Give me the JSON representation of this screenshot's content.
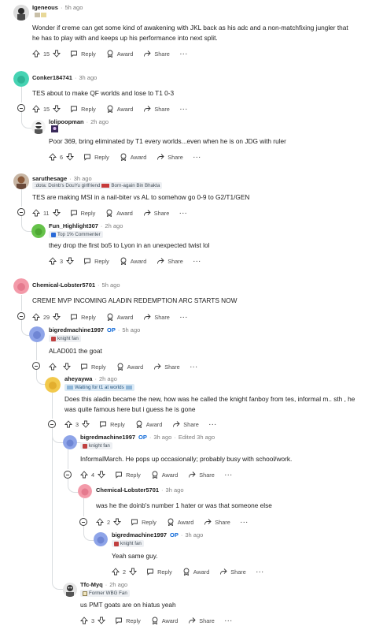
{
  "labels": {
    "reply": "Reply",
    "award": "Award",
    "share": "Share",
    "more": "···",
    "sep": "·"
  },
  "colors": {
    "op": "#0a66d8",
    "thread_line": "#dadde0",
    "text": "#1c1c1c"
  },
  "comments": {
    "c1": {
      "user": "Igeneous",
      "time": "5h ago",
      "flair_icons": [
        "emoji-badge-icon"
      ],
      "lines": [
        "Wonder if creme can get some kind of awakening with JKL back as his adc and a non-matchfixing jungler that",
        "he has to play with and keeps up his performance into next split."
      ],
      "votes": "15"
    },
    "c2": {
      "user": "Conker184741",
      "time": "3h ago",
      "lines": [
        "TES about to make QF worlds and lose to T1 0-3"
      ],
      "votes": "15"
    },
    "c3": {
      "user": "lolipoopman",
      "time": "2h ago",
      "flair_icons": [
        "character-badge-icon"
      ],
      "lines": [
        "Poor 369, bring eliminated by T1 every worlds...even when he is on JDG with ruler"
      ],
      "votes": "6"
    },
    "c4": {
      "user": "saruthesage",
      "time": "3h ago",
      "flair": [
        ":dota: Doinb's DouYu girlfriend",
        "Born-again Bin Bhakta"
      ],
      "lines": [
        "TES are making MSI in a nail-biter vs AL to somehow go 0-9 to G2/T1/GEN"
      ],
      "votes": "11"
    },
    "c5": {
      "user": "Fun_Highlight307",
      "time": "2h ago",
      "flair": [
        "Top 1% Commenter"
      ],
      "lines": [
        "they drop the first bo5 to Lyon in an unexpected twist lol"
      ],
      "votes": "3"
    },
    "c6": {
      "user": "Chemical-Lobster5701",
      "time": "5h ago",
      "lines": [
        "CREME MVP INCOMING ALADIN REDEMPTION ARC STARTS NOW"
      ],
      "votes": "29"
    },
    "c7": {
      "user": "bigredmachine1997",
      "op": "OP",
      "time": "5h ago",
      "flair": [
        "knight fan"
      ],
      "lines": [
        "ALAD001 the goat"
      ],
      "votes": ""
    },
    "c8": {
      "user": "aheyaywa",
      "time": "2h ago",
      "flair": [
        "Waiting for t1 at worlds"
      ],
      "lines": [
        "Does this aladin became the new, how was he called the knight fanboy from tes, informal m.. sth , he",
        "was quite famous here but i guess he is gone"
      ],
      "votes": "3"
    },
    "c9": {
      "user": "bigredmachine1997",
      "op": "OP",
      "time": "3h ago",
      "edited": "Edited 3h ago",
      "flair": [
        "knight fan"
      ],
      "lines": [
        "InformalMarch. He pops up occasionally; probably busy with school/work."
      ],
      "votes": "4"
    },
    "c10": {
      "user": "Chemical-Lobster5701",
      "time": "3h ago",
      "lines": [
        "was he the doinb's number 1 hater or was that someone else"
      ],
      "votes": "2"
    },
    "c11": {
      "user": "bigredmachine1997",
      "op": "OP",
      "time": "3h ago",
      "flair": [
        "knight fan"
      ],
      "lines": [
        "Yeah same guy."
      ],
      "votes": "2"
    },
    "c12": {
      "user": "Tfc-Myq",
      "time": "2h ago",
      "flair": [
        "Former WBG Fan"
      ],
      "lines": [
        "us PMT goats are on hiatus yeah"
      ],
      "votes": "3"
    }
  }
}
